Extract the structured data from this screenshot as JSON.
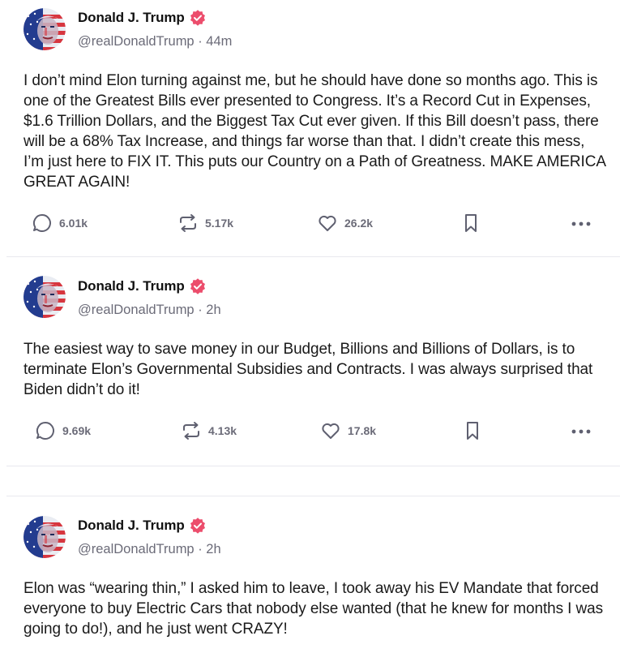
{
  "posts": [
    {
      "author": "Donald J. Trump",
      "handle": "@realDonaldTrump",
      "time": "44m",
      "text": "I don’t mind Elon turning against me, but he should have done so months ago. This is one of the Greatest Bills ever presented to Congress. It’s a Record Cut in Expenses, $1.6 Trillion Dollars, and the Biggest Tax Cut ever given. If this Bill doesn’t pass, there will be a 68% Tax Increase, and things far worse than that. I didn’t create this mess, I’m just here to FIX IT. This puts our Country on a Path of Greatness. MAKE AMERICA GREAT AGAIN!",
      "replies": "6.01k",
      "retruths": "5.17k",
      "likes": "26.2k"
    },
    {
      "author": "Donald J. Trump",
      "handle": "@realDonaldTrump",
      "time": "2h",
      "text": "The easiest way to save money in our Budget, Billions and Billions of Dollars, is to terminate Elon’s Governmental Subsidies and Contracts. I was always surprised that Biden didn’t do it!",
      "replies": "9.69k",
      "retruths": "4.13k",
      "likes": "17.8k"
    },
    {
      "author": "Donald J. Trump",
      "handle": "@realDonaldTrump",
      "time": "2h",
      "text": "Elon was “wearing thin,” I asked him to leave, I took away his EV Mandate that forced everyone to buy Electric Cars that nobody else wanted (that he knew for months I was going to do!), and he just went CRAZY!"
    }
  ],
  "separator": " · ",
  "colors": {
    "verified_badge": "#ec4d6c",
    "muted_text": "#6b6b78",
    "icon_stroke": "#5f6070",
    "divider": "#e8e8ee"
  },
  "icons": {
    "verified": "verified-badge-icon",
    "reply": "reply-bubble-icon",
    "retruth": "retruth-arrows-icon",
    "like": "heart-icon",
    "bookmark": "bookmark-icon",
    "more": "more-dots-icon"
  }
}
